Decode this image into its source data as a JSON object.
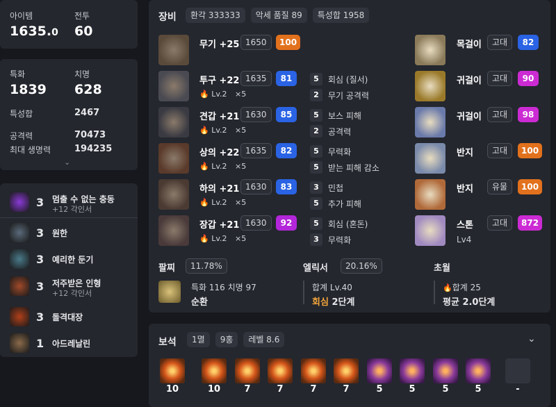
{
  "stats_top": {
    "item_label": "아이템",
    "item_value": "1635.",
    "item_decimal": "0",
    "battle_label": "전투",
    "battle_value": "60"
  },
  "stats": {
    "spec_label": "특화",
    "spec_value": "1839",
    "crit_label": "치명",
    "crit_value": "628",
    "total_label": "특성합",
    "total_value": "2467",
    "atk_label": "공격력",
    "atk_value": "70473",
    "hp_label": "최대 생명력",
    "hp_value": "194235"
  },
  "engravings": [
    {
      "level": "3",
      "name": "멈출 수 없는 충동",
      "sub": "+12 각인서",
      "color": "#8a3ad6"
    },
    {
      "level": "3",
      "name": "원한",
      "sub": "",
      "color": "#5a6a7a"
    },
    {
      "level": "3",
      "name": "예리한 둔기",
      "sub": "",
      "color": "#4a7a8a"
    },
    {
      "level": "3",
      "name": "저주받은 인형",
      "sub": "+12 각인서",
      "color": "#a04a2a"
    },
    {
      "level": "3",
      "name": "돌격대장",
      "sub": "",
      "color": "#b0401a"
    },
    {
      "level": "1",
      "name": "아드레날린",
      "sub": "",
      "color": "#8a6a4a"
    }
  ],
  "equip_header": {
    "title": "장비",
    "pill1": "환각 333333",
    "pill2": "악세 품질 89",
    "pill3": "특성합 1958"
  },
  "equipment": [
    {
      "name": "무기 +25",
      "ilvl": "1650",
      "quality": "100",
      "qcolor": "orange",
      "has_lv": false,
      "lv": "",
      "mult": "",
      "effects": []
    },
    {
      "name": "투구 +22",
      "ilvl": "1635",
      "quality": "81",
      "qcolor": "blue",
      "has_lv": true,
      "lv": "Lv.2",
      "mult": "×5",
      "effects": [
        {
          "n": "5",
          "t": "회심 (질서)"
        },
        {
          "n": "2",
          "t": "무기 공격력"
        }
      ]
    },
    {
      "name": "견갑 +21",
      "ilvl": "1630",
      "quality": "85",
      "qcolor": "blue",
      "has_lv": true,
      "lv": "Lv.2",
      "mult": "×5",
      "effects": [
        {
          "n": "5",
          "t": "보스 피해"
        },
        {
          "n": "2",
          "t": "공격력"
        }
      ]
    },
    {
      "name": "상의 +22",
      "ilvl": "1635",
      "quality": "82",
      "qcolor": "blue",
      "has_lv": true,
      "lv": "Lv.2",
      "mult": "×5",
      "effects": [
        {
          "n": "5",
          "t": "무력화"
        },
        {
          "n": "5",
          "t": "받는 피해 감소"
        }
      ]
    },
    {
      "name": "하의 +21",
      "ilvl": "1630",
      "quality": "83",
      "qcolor": "blue",
      "has_lv": true,
      "lv": "Lv.2",
      "mult": "×5",
      "effects": [
        {
          "n": "3",
          "t": "민첩"
        },
        {
          "n": "5",
          "t": "추가 피해"
        }
      ]
    },
    {
      "name": "장갑 +21",
      "ilvl": "1630",
      "quality": "92",
      "qcolor": "purple",
      "has_lv": true,
      "lv": "Lv.2",
      "mult": "×5",
      "effects": [
        {
          "n": "5",
          "t": "회심 (혼돈)"
        },
        {
          "n": "3",
          "t": "무력화"
        }
      ]
    }
  ],
  "accessories": [
    {
      "name": "목걸이",
      "grade": "고대",
      "quality": "82",
      "qcolor": "blue"
    },
    {
      "name": "귀걸이",
      "grade": "고대",
      "quality": "90",
      "qcolor": "pink"
    },
    {
      "name": "귀걸이",
      "grade": "고대",
      "quality": "98",
      "qcolor": "pink"
    },
    {
      "name": "반지",
      "grade": "고대",
      "quality": "100",
      "qcolor": "orange"
    },
    {
      "name": "반지",
      "grade": "유물",
      "quality": "100",
      "qcolor": "orange"
    },
    {
      "name": "스톤",
      "grade": "고대",
      "quality": "872",
      "qcolor": "pink",
      "sub": "Lv4"
    }
  ],
  "bracelet": {
    "title": "팔찌",
    "pct": "11.78%",
    "line1": "특화 116  치명 97",
    "line2": "순환"
  },
  "elixir": {
    "title": "엘릭서",
    "pct": "20.16%",
    "line1": "합계 Lv.40",
    "line2a": "회심",
    "line2b": "2단계"
  },
  "transcend": {
    "title": "초월",
    "line1": "합계 25",
    "line2": "평균 2.0단계"
  },
  "gems_header": {
    "title": "보석",
    "pill1": "1멸",
    "pill2": "9홍",
    "pill3": "레벨 8.6"
  },
  "gems": [
    {
      "level": "10",
      "type": "orange"
    },
    {
      "level": "10",
      "type": "orange"
    },
    {
      "level": "7",
      "type": "orange"
    },
    {
      "level": "7",
      "type": "orange"
    },
    {
      "level": "7",
      "type": "orange"
    },
    {
      "level": "7",
      "type": "orange"
    },
    {
      "level": "5",
      "type": "purple"
    },
    {
      "level": "5",
      "type": "purple"
    },
    {
      "level": "5",
      "type": "purple"
    },
    {
      "level": "5",
      "type": "purple"
    },
    {
      "level": "-",
      "type": "empty"
    }
  ]
}
